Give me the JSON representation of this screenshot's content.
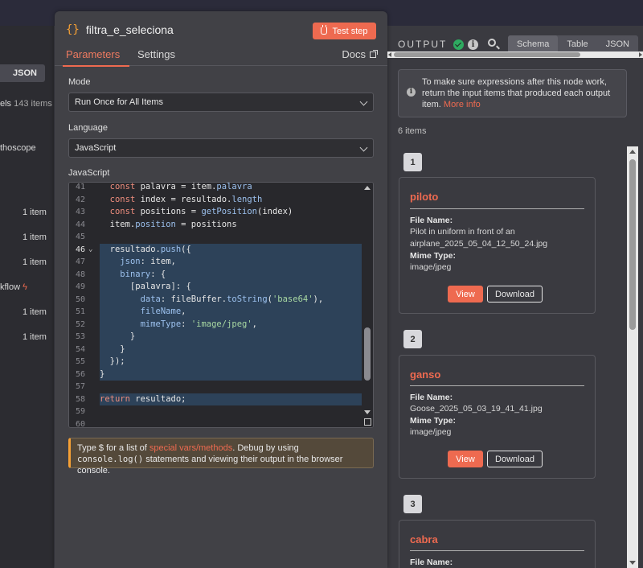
{
  "left_panel": {
    "json_button": "JSON",
    "items_label": "els",
    "items_count": "143 items",
    "oscope": "thoscope",
    "rows": [
      "1 item",
      "1 item",
      "1 item",
      "1 item",
      "1 item"
    ],
    "workflow": "kflow"
  },
  "node": {
    "title": "filtra_e_seleciona",
    "test_button": "Test step",
    "tabs": [
      "Parameters",
      "Settings"
    ],
    "docs": "Docs",
    "mode_label": "Mode",
    "mode_value": "Run Once for All Items",
    "language_label": "Language",
    "language_value": "JavaScript",
    "code_label": "JavaScript",
    "code_lines": [
      {
        "n": "41",
        "text": "  const palavra = item.palavra"
      },
      {
        "n": "42",
        "text": "  const index = resultado.length"
      },
      {
        "n": "43",
        "text": "  const positions = getPosition(index)"
      },
      {
        "n": "44",
        "text": "  item.position = positions"
      },
      {
        "n": "45",
        "text": ""
      },
      {
        "n": "46",
        "text": "  resultado.push({"
      },
      {
        "n": "47",
        "text": "    json: item,"
      },
      {
        "n": "48",
        "text": "    binary: {"
      },
      {
        "n": "49",
        "text": "      [palavra]: {"
      },
      {
        "n": "50",
        "text": "        data: fileBuffer.toString('base64'),"
      },
      {
        "n": "51",
        "text": "        fileName,"
      },
      {
        "n": "52",
        "text": "        mimeType: 'image/jpeg',"
      },
      {
        "n": "53",
        "text": "      }"
      },
      {
        "n": "54",
        "text": "    }"
      },
      {
        "n": "55",
        "text": "  });"
      },
      {
        "n": "56",
        "text": "}"
      },
      {
        "n": "57",
        "text": ""
      },
      {
        "n": "58",
        "text": "return resultado;"
      },
      {
        "n": "59",
        "text": ""
      },
      {
        "n": "60",
        "text": ""
      }
    ],
    "hint_pre": "Type $ for a list of ",
    "hint_link": "special vars/methods",
    "hint_mid": ". Debug by using ",
    "hint_code": "console.log()",
    "hint_post": " statements and viewing their output in the browser console."
  },
  "output": {
    "title": "OUTPUT",
    "view_tabs": [
      "Schema",
      "Table",
      "JSON"
    ],
    "notice_text": "To make sure expressions after this node work, return the input items that produced each output item.",
    "notice_link": "More info",
    "items_count": "6 items",
    "field_name_label": "File Name:",
    "field_mime_label": "Mime Type:",
    "view_label": "View",
    "download_label": "Download",
    "items": [
      {
        "index": "1",
        "title": "piloto",
        "file_name": "Pilot in uniform in front of an airplane_2025_05_04_12_50_24.jpg",
        "mime": "image/jpeg"
      },
      {
        "index": "2",
        "title": "ganso",
        "file_name": "Goose_2025_05_03_19_41_41.jpg",
        "mime": "image/jpeg"
      },
      {
        "index": "3",
        "title": "cabra",
        "file_name": "",
        "mime": ""
      }
    ]
  },
  "colors": {
    "accent": "#ee6a50",
    "success": "#2eaa60",
    "warning": "#f5a035"
  }
}
